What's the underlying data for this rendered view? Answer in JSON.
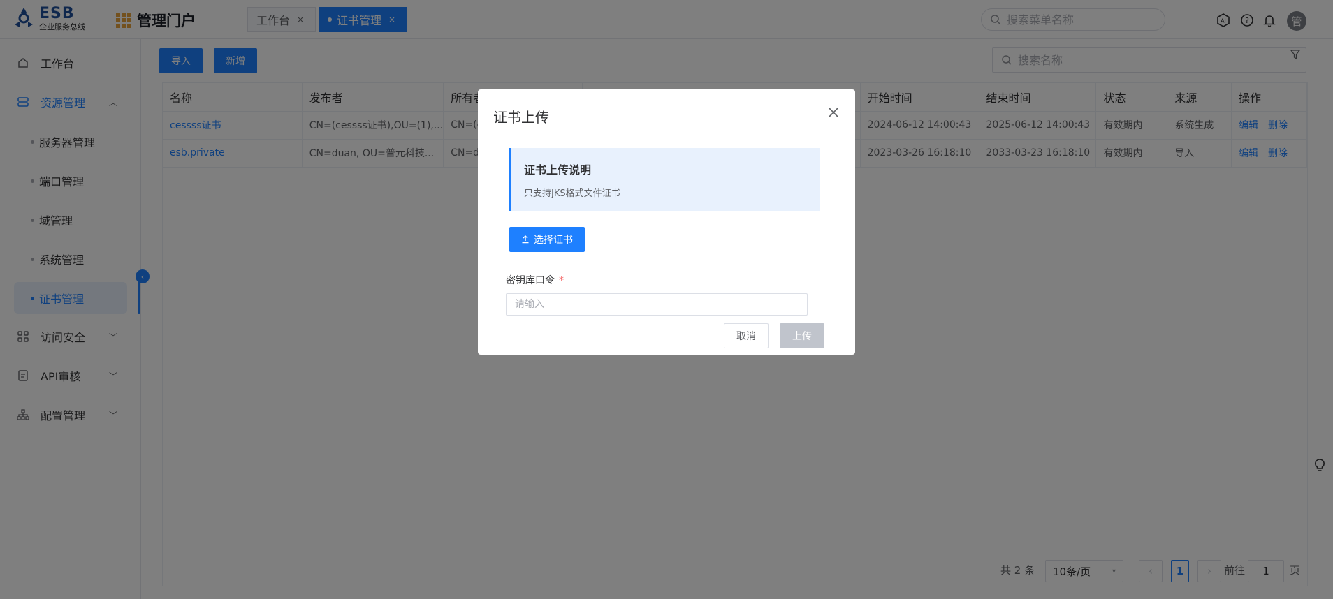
{
  "header": {
    "logo_big": "ESB",
    "logo_small": "企业服务总线",
    "portal_title": "管理门户",
    "tabs": [
      {
        "label": "工作台",
        "close": "×"
      },
      {
        "label": "证书管理",
        "close": "×"
      }
    ],
    "search_placeholder": "搜索菜单名称",
    "avatar_text": "管"
  },
  "sidebar": {
    "items": [
      {
        "label": "工作台"
      },
      {
        "label": "资源管理",
        "chevron": "︿"
      },
      {
        "label": "访问安全",
        "chevron": "﹀"
      },
      {
        "label": "API审核",
        "chevron": "﹀"
      },
      {
        "label": "配置管理",
        "chevron": "﹀"
      }
    ],
    "sub_items": [
      {
        "label": "服务器管理"
      },
      {
        "label": "端口管理"
      },
      {
        "label": "域管理"
      },
      {
        "label": "系统管理"
      },
      {
        "label": "证书管理"
      }
    ],
    "collapse_glyph": "‹"
  },
  "toolbar": {
    "import_label": "导入",
    "add_label": "新增",
    "search_placeholder": "搜索名称"
  },
  "table": {
    "columns": [
      "名称",
      "发布者",
      "所有者",
      "",
      "开始时间",
      "结束时间",
      "状态",
      "来源",
      "操作"
    ],
    "rows": [
      {
        "name": "cessss证书",
        "publisher": "CN=(cessss证书),OU=(1),...",
        "owner": "CN=(c",
        "start": "2024-06-12 14:00:43",
        "end": "2025-06-12 14:00:43",
        "status": "有效期内",
        "source": "系统生成",
        "edit": "编辑",
        "delete": "删除"
      },
      {
        "name": "esb.private",
        "publisher": "CN=duan, OU=普元科技...",
        "owner": "CN=du",
        "start": "2023-03-26 16:18:10",
        "end": "2033-03-23 16:18:10",
        "status": "有效期内",
        "source": "导入",
        "edit": "编辑",
        "delete": "删除"
      }
    ]
  },
  "pagination": {
    "total": "共 2 条",
    "page_size": "10条/页",
    "prev": "‹",
    "current": "1",
    "next": "›",
    "goto_label": "前往",
    "goto_value": "1",
    "page_suffix": "页"
  },
  "dialog": {
    "title": "证书上传",
    "notice_title": "证书上传说明",
    "notice_desc": "只支持JKS格式文件证书",
    "choose_label": "选择证书",
    "password_label": "密钥库口令",
    "required_mark": "*",
    "password_placeholder": "请输入",
    "cancel_label": "取消",
    "upload_label": "上传"
  },
  "colors": {
    "accent": "#1e80ff",
    "mask": "rgba(0,0,0,0.5)"
  }
}
